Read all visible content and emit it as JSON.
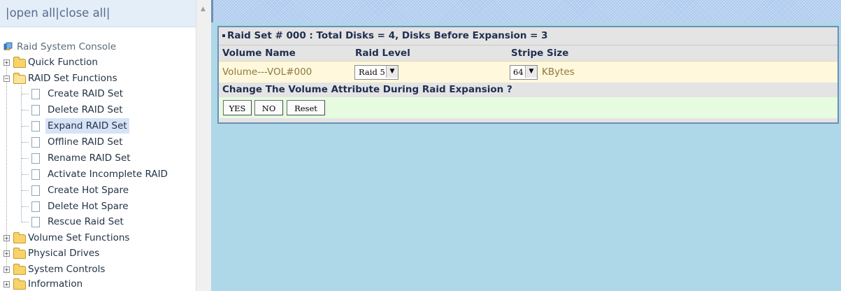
{
  "nav": {
    "top_links": {
      "open_all": "open all",
      "close_all": "close all",
      "separator": "|"
    },
    "root": "Raid System Console",
    "folders": {
      "quick_function": "Quick Function",
      "raid_set_functions": "RAID Set Functions",
      "volume_set_functions": "Volume Set Functions",
      "physical_drives": "Physical Drives",
      "system_controls": "System Controls",
      "information": "Information"
    },
    "raid_items": [
      "Create RAID Set",
      "Delete RAID Set",
      "Expand RAID Set",
      "Offline RAID Set",
      "Rename RAID Set",
      "Activate Incomplete RAID",
      "Create Hot Spare",
      "Delete Hot Spare",
      "Rescue Raid Set"
    ],
    "selected_item": "Expand RAID Set"
  },
  "form": {
    "title": "Raid Set # 000 : Total Disks = 4, Disks Before Expansion = 3",
    "columns": {
      "volume_name": "Volume Name",
      "raid_level": "Raid Level",
      "stripe_size": "Stripe Size"
    },
    "row": {
      "volume_name": "Volume---VOL#000",
      "raid_level": "Raid 5",
      "stripe_size": "64",
      "stripe_unit": "KBytes"
    },
    "question": "Change The Volume Attribute During Raid Expansion ?",
    "buttons": {
      "yes": "YES",
      "no": "NO",
      "reset": "Reset"
    }
  },
  "colors": {
    "accent_border": "#6e8fb5",
    "data_row_bg": "#fff8dc",
    "button_row_bg": "#e6fbe0",
    "content_bg": "#aed8e8",
    "header_text": "#1f2f4f"
  },
  "icons": [
    "console-icon",
    "folder-icon",
    "folder-open-icon",
    "page-icon",
    "plus-icon",
    "minus-icon",
    "dropdown-arrow-icon",
    "scroll-up-icon"
  ]
}
